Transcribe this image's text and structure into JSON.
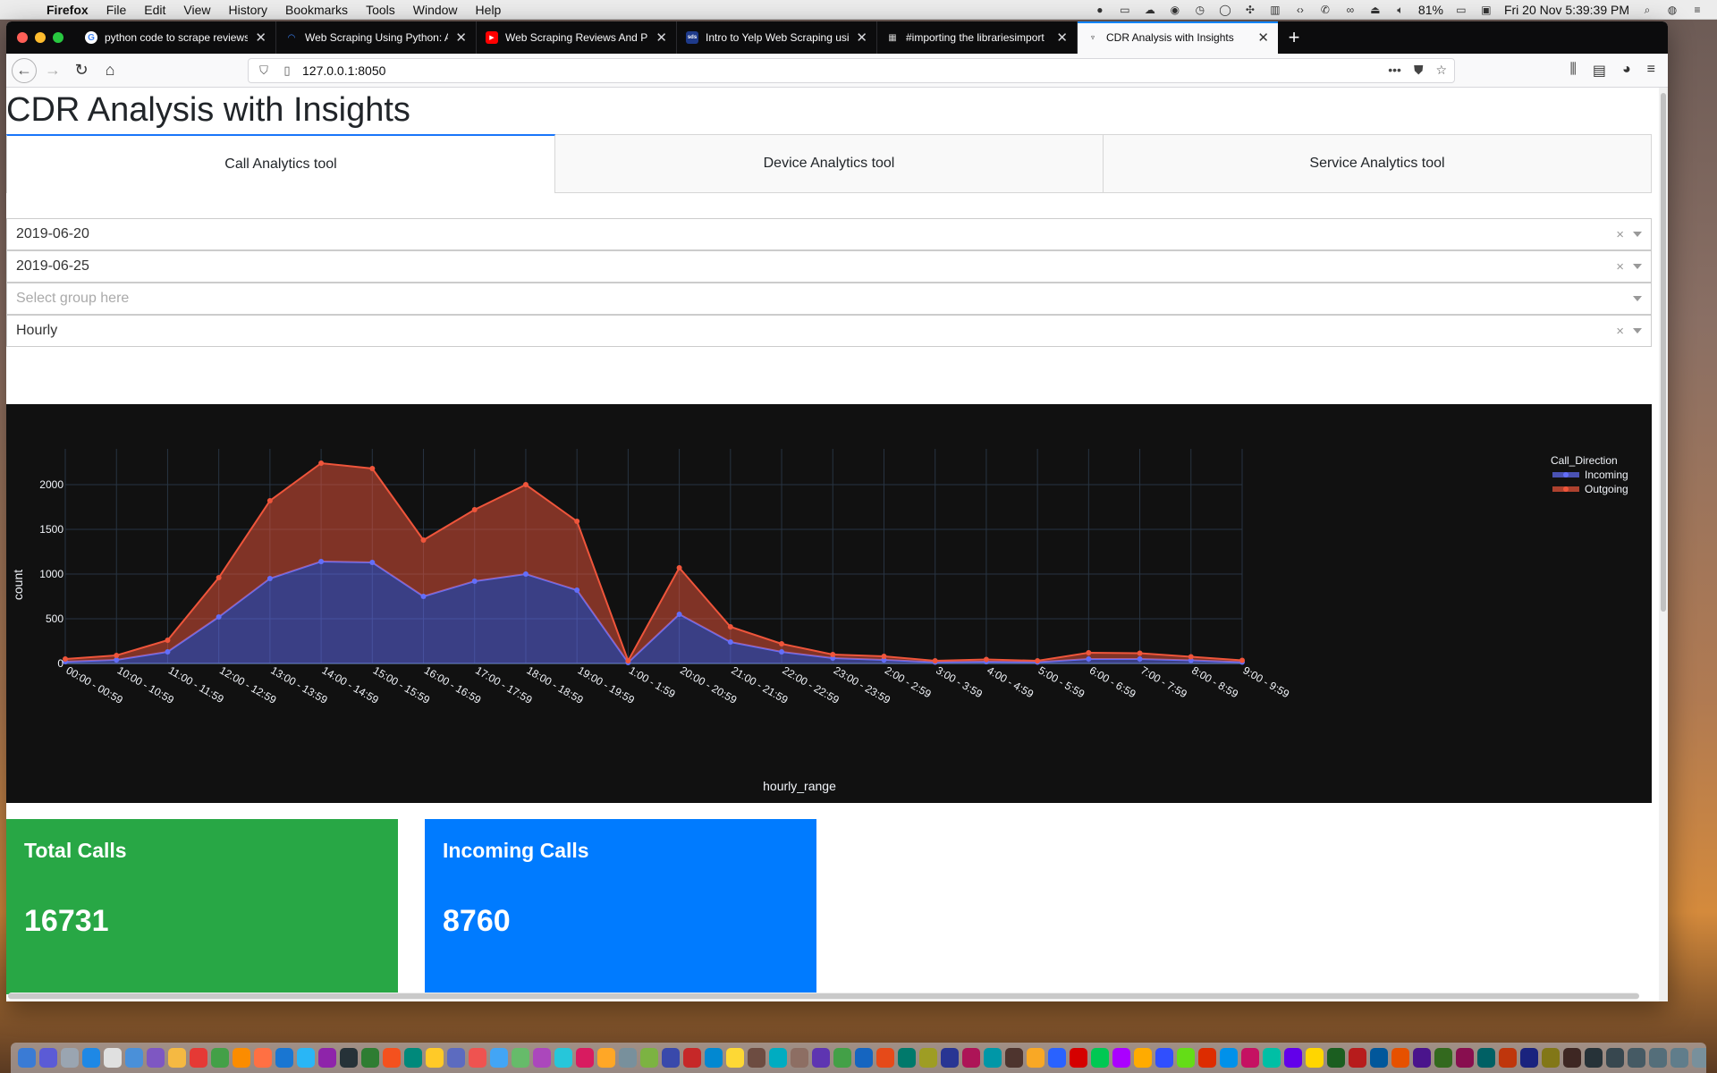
{
  "menubar": {
    "app": "Firefox",
    "items": [
      "File",
      "Edit",
      "View",
      "History",
      "Bookmarks",
      "Tools",
      "Window",
      "Help"
    ],
    "battery": "81%",
    "clock": "Fri 20 Nov  5:39:39 PM"
  },
  "tabs": [
    {
      "title": "python code to scrape reviews",
      "favicon_color": "#ffffff",
      "favicon_text": "G"
    },
    {
      "title": "Web Scraping Using Python: A",
      "favicon_color": "#3b82f6",
      "favicon_text": "◠"
    },
    {
      "title": "Web Scraping Reviews And Pro",
      "favicon_color": "#ff0000",
      "favicon_text": "▶"
    },
    {
      "title": "Intro to Yelp Web Scraping usi",
      "favicon_color": "#1e3a8a",
      "favicon_text": "sds"
    },
    {
      "title": "#importing the librariesimport",
      "favicon_color": "#555555",
      "favicon_text": "▦"
    },
    {
      "title": "CDR Analysis with Insights",
      "favicon_color": "#f9f9fa",
      "favicon_text": "♆"
    }
  ],
  "url": "127.0.0.1:8050",
  "page": {
    "title": "CDR Analysis with Insights",
    "tabs": [
      "Call Analytics tool",
      "Device Analytics tool",
      "Service Analytics tool"
    ],
    "dropdowns": [
      {
        "value": "2019-06-20",
        "placeholder": "",
        "clearable": true
      },
      {
        "value": "2019-06-25",
        "placeholder": "",
        "clearable": true
      },
      {
        "value": "",
        "placeholder": "Select group here",
        "clearable": false
      },
      {
        "value": "Hourly",
        "placeholder": "",
        "clearable": true
      }
    ],
    "cards": [
      {
        "title": "Total Calls",
        "value": "16731",
        "color": "#28a745"
      },
      {
        "title": "Incoming Calls",
        "value": "8760",
        "color": "#007bff"
      }
    ]
  },
  "chart_data": {
    "type": "area",
    "stacked": true,
    "title": "",
    "xlabel": "hourly_range",
    "ylabel": "count",
    "ylim": [
      0,
      2400
    ],
    "yticks": [
      0,
      500,
      1000,
      1500,
      2000
    ],
    "legend": {
      "title": "Call_Direction",
      "placement": "top-right"
    },
    "categories": [
      "00:00 - 00:59",
      "10:00 - 10:59",
      "11:00 - 11:59",
      "12:00 - 12:59",
      "13:00 - 13:59",
      "14:00 - 14:59",
      "15:00 - 15:59",
      "16:00 - 16:59",
      "17:00 - 17:59",
      "18:00 - 18:59",
      "19:00 - 19:59",
      "1:00 - 1:59",
      "20:00 - 20:59",
      "21:00 - 21:59",
      "22:00 - 22:59",
      "23:00 - 23:59",
      "2:00 - 2:59",
      "3:00 - 3:59",
      "4:00 - 4:59",
      "5:00 - 5:59",
      "6:00 - 6:59",
      "7:00 - 7:59",
      "8:00 - 8:59",
      "9:00 - 9:59"
    ],
    "series": [
      {
        "name": "Incoming",
        "color": "#636efa",
        "values": [
          20,
          40,
          130,
          520,
          950,
          1140,
          1130,
          750,
          920,
          1000,
          820,
          10,
          550,
          240,
          130,
          60,
          40,
          15,
          20,
          15,
          50,
          50,
          35,
          15
        ]
      },
      {
        "name": "Outgoing",
        "color": "#ef553b",
        "values": [
          30,
          50,
          130,
          440,
          870,
          1100,
          1050,
          630,
          800,
          1000,
          770,
          20,
          520,
          170,
          90,
          40,
          40,
          15,
          25,
          15,
          70,
          65,
          40,
          20
        ]
      }
    ]
  }
}
